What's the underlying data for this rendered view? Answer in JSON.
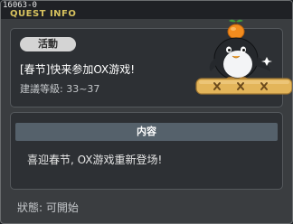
{
  "window": {
    "quest_id": "16063-0",
    "title": "QUEST INFO"
  },
  "quest": {
    "category_label": "活動",
    "name": "[春节]快来参加OX游戏!",
    "recommended_level": "建議等級: 33~37"
  },
  "content": {
    "header": "内容",
    "text": "喜迎春节, OX游戏重新登场!"
  },
  "status": {
    "text": "狀態: 可開始"
  },
  "icons": {
    "npc": "penguin-with-orange-icon",
    "board": "ox-board-icon"
  },
  "colors": {
    "title": "#d7c25e",
    "board": "#e3b55a",
    "orange": "#f28c1e"
  }
}
